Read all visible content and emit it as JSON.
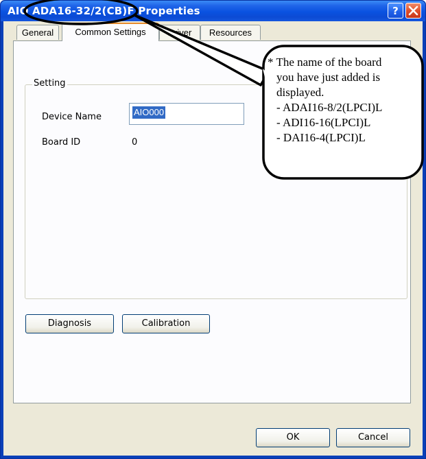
{
  "window": {
    "title": "AIO ADA16-32/2(CB)F Properties",
    "help_button": "?",
    "close_button": "✕"
  },
  "tabs": [
    {
      "label": "General"
    },
    {
      "label": "Common Settings"
    },
    {
      "label": "Driver"
    },
    {
      "label": "Resources"
    }
  ],
  "setting_group": {
    "label": "Setting",
    "device_name_label": "Device Name",
    "device_name_value": "AIO000",
    "board_id_label": "Board ID",
    "board_id_value": "0"
  },
  "buttons": {
    "diagnosis": "Diagnosis",
    "calibration": "Calibration",
    "ok": "OK",
    "cancel": "Cancel"
  },
  "callout": {
    "line1": "* The name of the board",
    "line2": "you have just added is",
    "line3": "displayed.",
    "item1": "- ADAI16-8/2(LPCI)L",
    "item2": "- ADI16-16(LPCI)L",
    "item3": "- DAI16-4(LPCI)L"
  },
  "colors": {
    "titlebar": "#0a52e0",
    "dialog_face": "#ece9d8",
    "active_tab_accent": "#e68b2c",
    "selection": "#316ac5"
  },
  "icons": {
    "help": "help-icon",
    "close": "close-icon"
  }
}
